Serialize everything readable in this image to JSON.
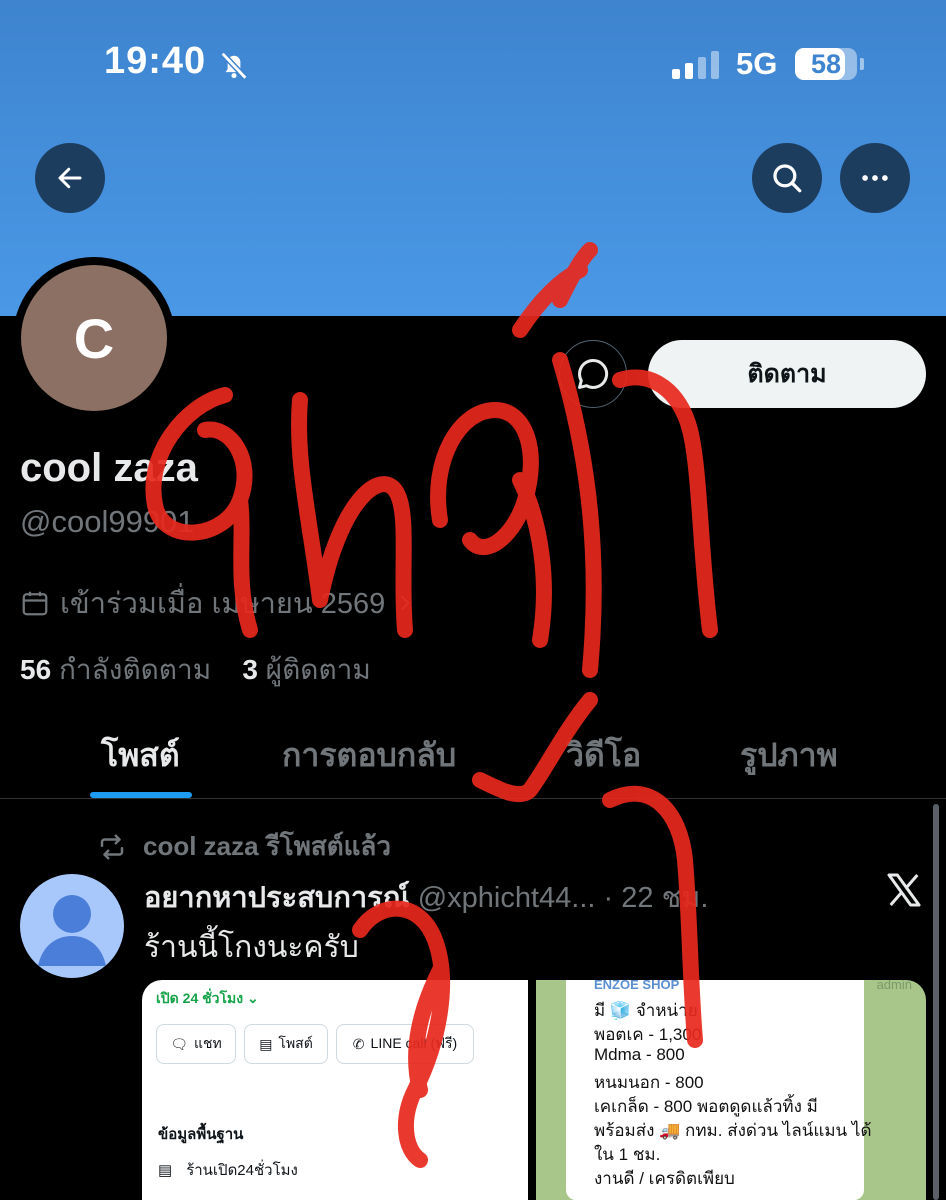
{
  "status_bar": {
    "time": "19:40",
    "network": "5G",
    "battery": "58",
    "battery_level": 0.58
  },
  "header": {
    "back_icon": "arrow-left-icon",
    "search_icon": "search-icon",
    "more_icon": "more-horizontal-icon"
  },
  "profile": {
    "avatar_letter": "C",
    "follow_label": "ติดตาม",
    "name": "cool zaza",
    "handle": "@cool99901",
    "joined": "เข้าร่วมเมื่อ เมษายน 2569",
    "following_count": "56",
    "following_label": "กำลังติดตาม",
    "followers_count": "3",
    "followers_label": "ผู้ติดตาม"
  },
  "tabs": [
    "โพสต์",
    "การตอบกลับ",
    "วิดีโอ",
    "รูปภาพ"
  ],
  "post": {
    "repost_label": "cool zaza รีโพสต์แล้ว",
    "author_name": "อยากหาประสบการณ์",
    "author_handle": "@xphicht44...",
    "time": "22 ชม.",
    "text": "ร้านนี้โกงนะครับ",
    "media_left": {
      "open_label": "เปิด 24 ชั่วโมง",
      "chat_label": "แชท",
      "post_label": "โพสต์",
      "line_label": "LINE call (ฟรี)",
      "basic_info_label": "ข้อมูลพื้นฐาน",
      "row_text": "ร้านเปิด24ชั่วโมง"
    },
    "media_right": {
      "shop_name": "ENZOE SHOP",
      "admin_label": "admin",
      "lines": [
        "มี 🧊 จำหน่าย",
        "พอตเค - 1,300",
        "Mdma - 800",
        "หนมนอก - 800",
        "เคเกล็ด - 800      พอตดูดแล้วทิ้ง  มี",
        "พร้อมส่ง 🚚 กทม. ส่งด่วน ไลน์แมน ได้",
        "ใน 1 ชม.",
        "งานดี / เครดิตเพียบ"
      ]
    }
  },
  "overlay": {
    "description_color": "#e8281c"
  }
}
